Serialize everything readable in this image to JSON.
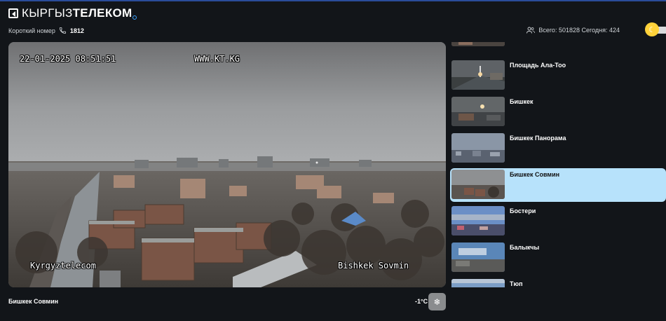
{
  "header": {
    "logo_text_bold": "КЫРГЫЗ",
    "logo_text_tail": "ТЕЛЕКОМ",
    "short_number_label": "Короткий номер",
    "short_number_value": "1812",
    "stats_text": "Всего: 501828 Сегодня: 424"
  },
  "theme": {
    "mode": "dark",
    "knob_icon": "moon-icon",
    "accent": "#ffd23a"
  },
  "camera": {
    "osd_datetime": "22-01-2025 08:51:51",
    "osd_url": "WWW.KT.KG",
    "osd_brand": "Kyrgyztelecom",
    "osd_location": "Bishkek Sovmin",
    "caption": "Бишкек Совмин",
    "temperature": "-1°C",
    "weather_icon": "snowflake-icon"
  },
  "cameras": [
    {
      "label": "",
      "active": false
    },
    {
      "label": "Площадь Ала-Тоо",
      "active": false
    },
    {
      "label": "Бишкек",
      "active": false
    },
    {
      "label": "Бишкек Панорама",
      "active": false
    },
    {
      "label": "Бишкек Совмин",
      "active": true
    },
    {
      "label": "Бостери",
      "active": false
    },
    {
      "label": "Балыкчы",
      "active": false
    },
    {
      "label": "Тюп",
      "active": false
    }
  ]
}
